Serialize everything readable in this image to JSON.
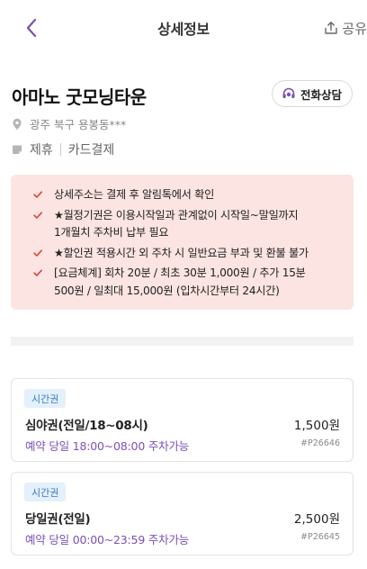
{
  "header": {
    "title": "상세정보",
    "share_label": "공유"
  },
  "store": {
    "name": "아마노 굿모닝타운",
    "call_label": "전화상담",
    "address": "광주 북구 용봉동***",
    "tags": [
      "제휴",
      "카드결제"
    ]
  },
  "notices": [
    "상세주소는 결제 후 알림톡에서 확인",
    "★월정기권은 이용시작일과 관계없이 시작일~말일까지\n1개월치 주차비 납부 필요",
    "★할인권 적용시간 외 주차 시 일반요금 부과 및 환불 불가",
    "[요금체계] 회차 20분 / 최초 30분 1,000원 / 추가 15분\n500원 / 일최대 15,000원 (입차시간부터 24시간)"
  ],
  "tickets": [
    {
      "badge": "시간권",
      "name": "심야권(전일/18~08시)",
      "price": "1,500원",
      "time": "예약 당일 18:00~08:00 주차가능",
      "code": "#P26646"
    },
    {
      "badge": "시간권",
      "name": "당일권(전일)",
      "price": "2,500원",
      "time": "예약 당일 00:00~23:59 주차가능",
      "code": "#P26645"
    }
  ],
  "colors": {
    "accent_purple": "#7b4fb8",
    "notice_bg": "#fbe4e1",
    "check_red": "#d9453b",
    "badge_bg": "#e4f0fb",
    "badge_text": "#3a7cc4"
  }
}
